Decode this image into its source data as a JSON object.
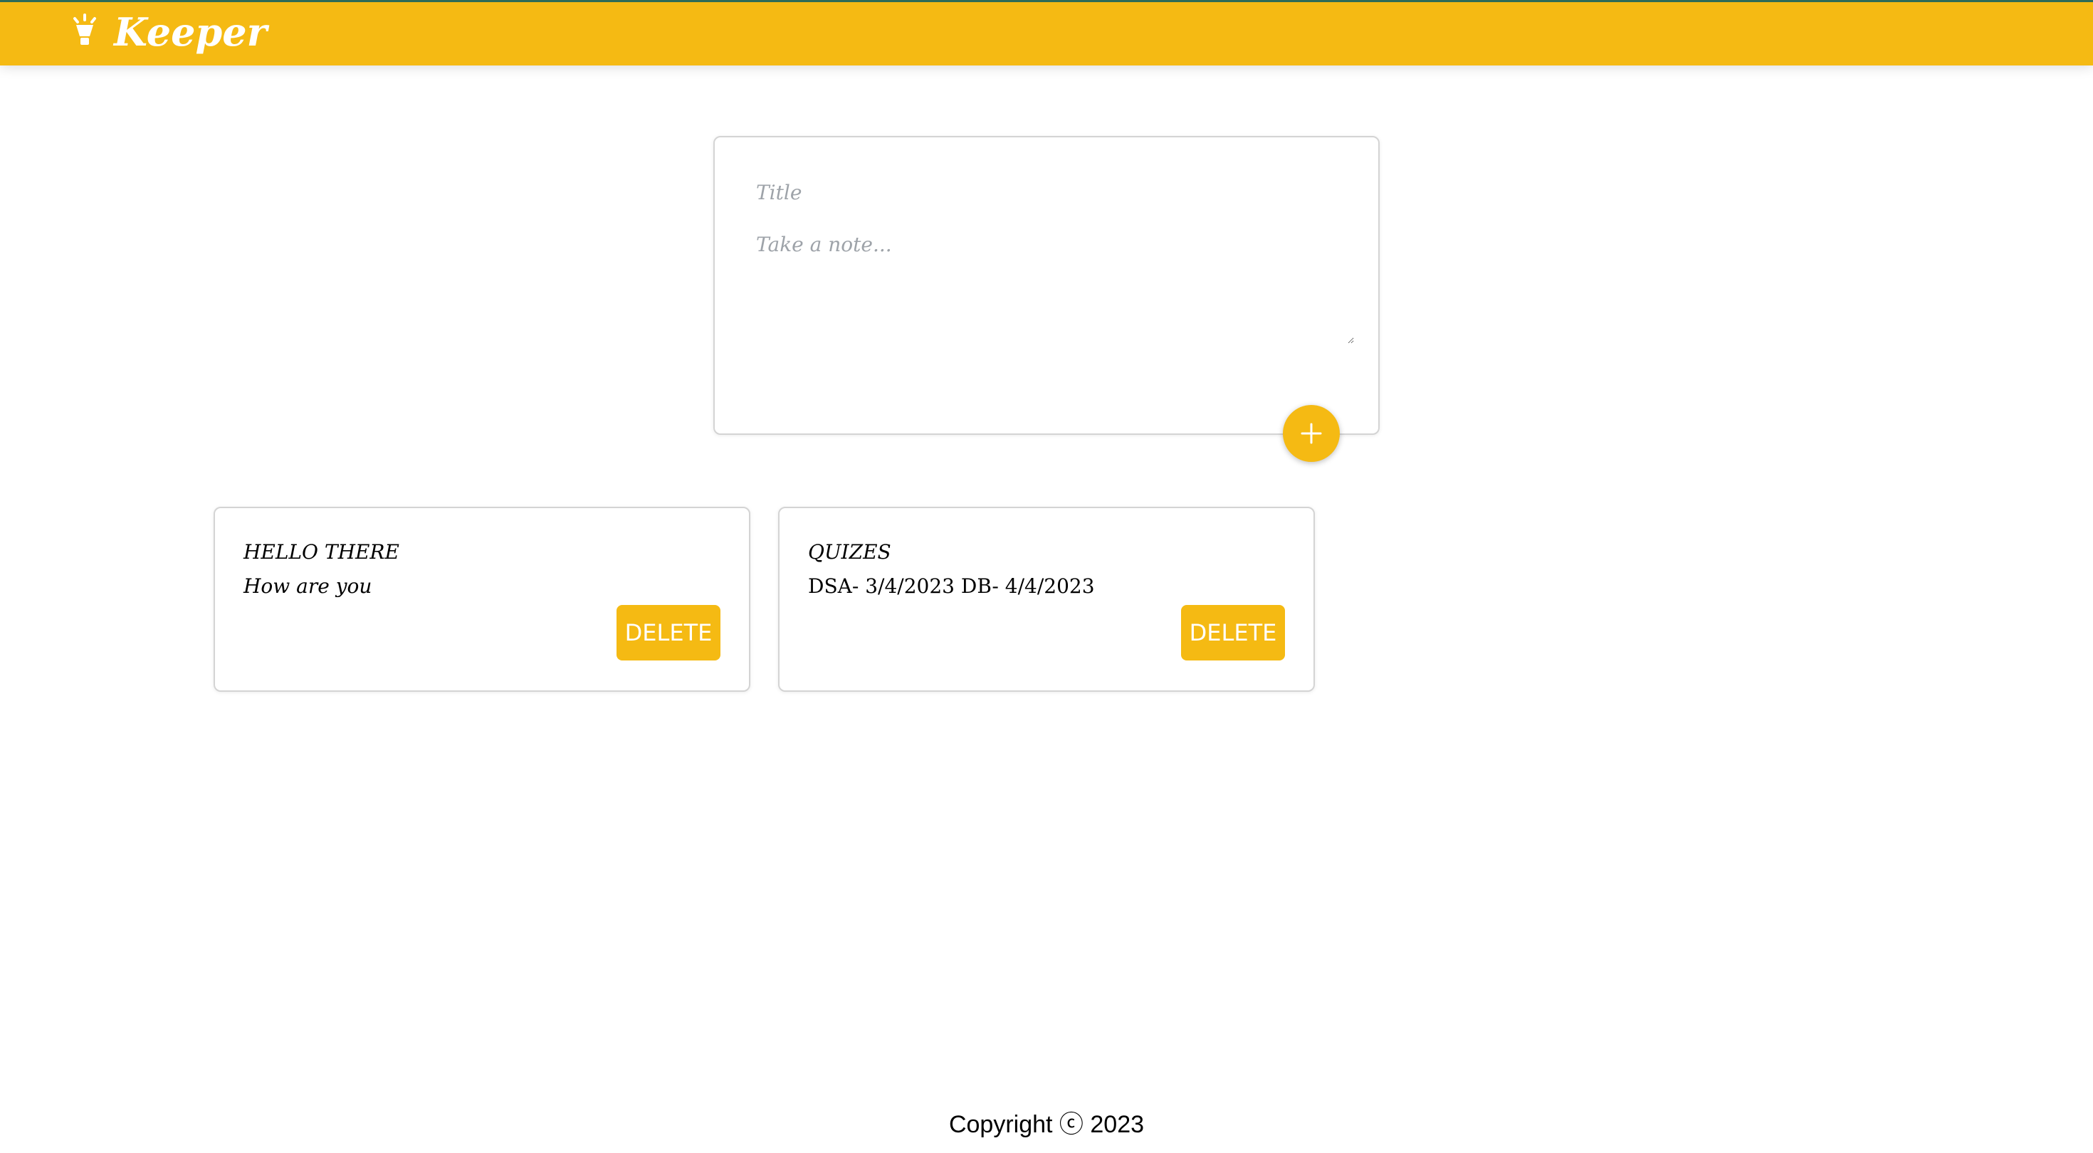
{
  "header": {
    "app_title": "Keeper",
    "logo_icon": "lightbulb-icon"
  },
  "create_area": {
    "title_placeholder": "Title",
    "content_placeholder": "Take a note...",
    "add_icon": "plus-icon"
  },
  "notes": [
    {
      "title": "HELLO THERE",
      "content": "How are you",
      "delete_label": "DELETE"
    },
    {
      "title": "QUIZES",
      "content": "DSA- 3/4/2023 DB- 4/4/2023",
      "delete_label": "DELETE"
    }
  ],
  "footer": {
    "copyright": "Copyright ⓒ 2023"
  },
  "colors": {
    "accent": "#f5ba13",
    "border": "#d4d4d4",
    "placeholder": "#9ea3a9"
  }
}
